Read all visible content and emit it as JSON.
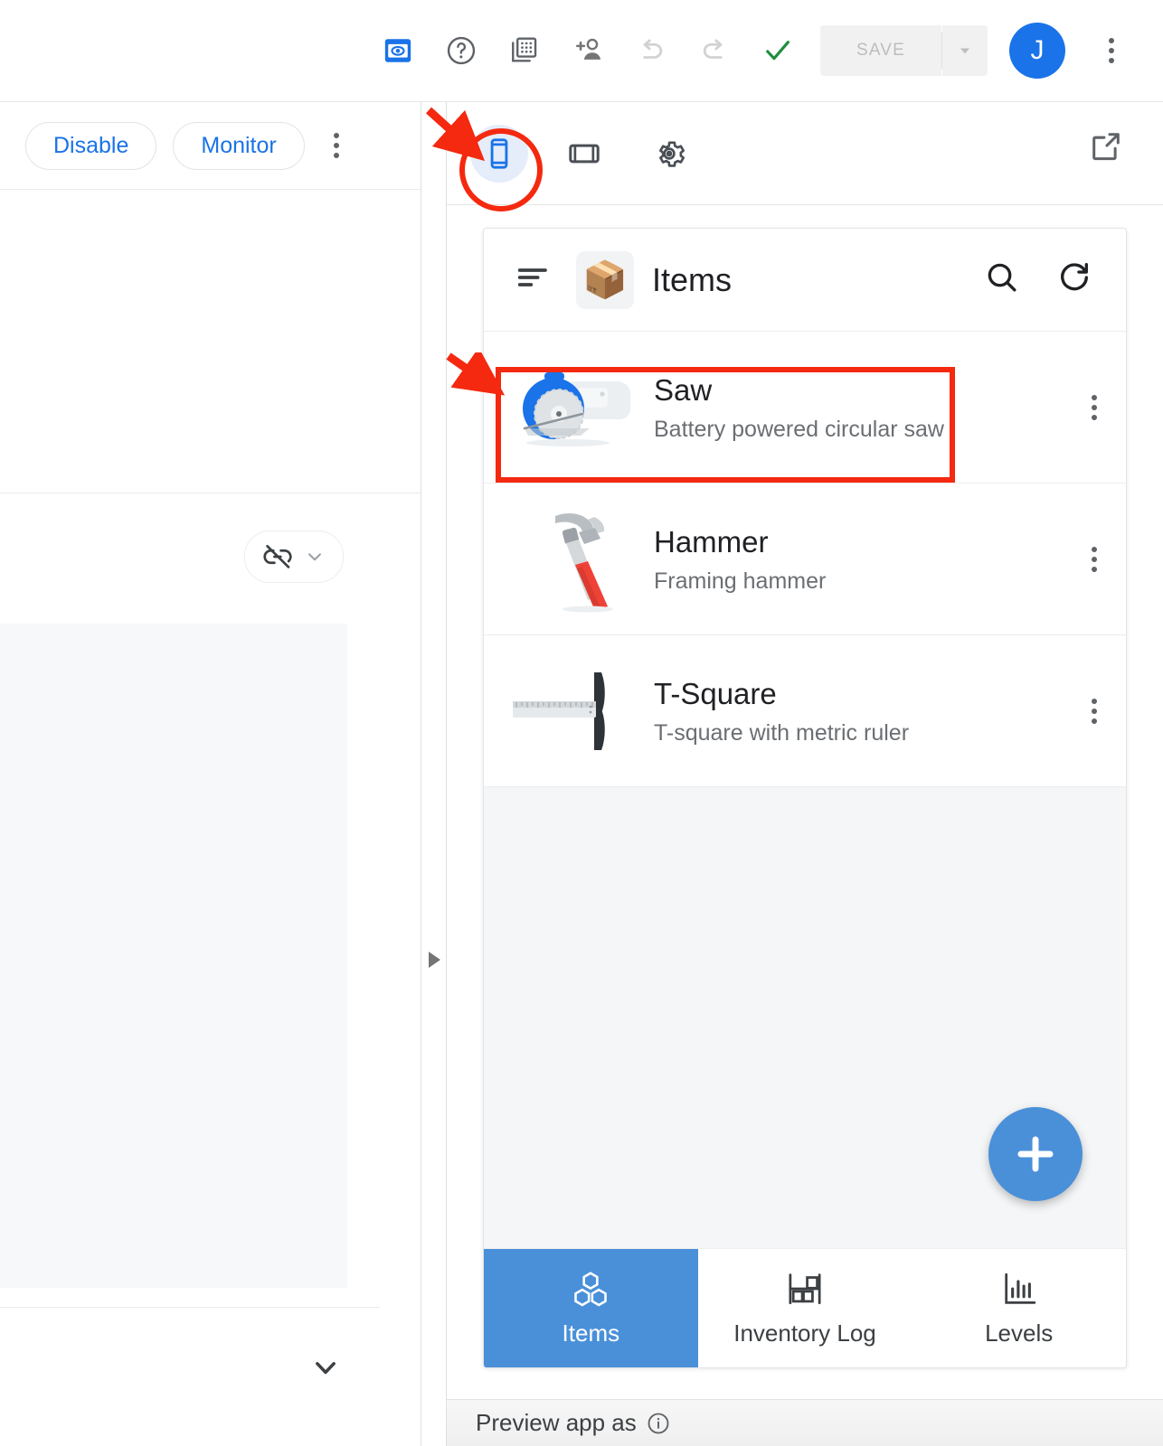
{
  "toolbar": {
    "icons": [
      {
        "name": "preview-icon",
        "label": "Preview"
      },
      {
        "name": "help-icon",
        "label": "Help"
      },
      {
        "name": "app-gallery-icon",
        "label": "App gallery"
      },
      {
        "name": "add-person-icon",
        "label": "Share"
      },
      {
        "name": "undo-icon",
        "label": "Undo"
      },
      {
        "name": "redo-icon",
        "label": "Redo"
      },
      {
        "name": "check-icon",
        "label": "Validated"
      }
    ],
    "save_label": "SAVE",
    "save_enabled": false,
    "save_dropdown_icon": "chevron-down-icon",
    "avatar_initial": "J",
    "overflow_icon": "more-vert-icon"
  },
  "left_panel": {
    "disable_label": "Disable",
    "monitor_label": "Monitor",
    "overflow_icon": "more-vert-icon",
    "link_off_icon": "link-off-icon",
    "link_dropdown_icon": "chevron-down-icon",
    "expand_icon": "chevron-down-icon"
  },
  "split_handle": {
    "expander_icon": "triangle-right-icon"
  },
  "preview_toolbar": {
    "devices": [
      {
        "name": "phone-view-button",
        "icon": "phone-icon",
        "label": "Phone",
        "active": true
      },
      {
        "name": "tablet-view-button",
        "icon": "tablet-icon",
        "label": "Tablet",
        "active": false
      },
      {
        "name": "preview-settings-button",
        "icon": "gear-icon",
        "label": "Settings",
        "active": false
      }
    ],
    "open_external_icon": "open-in-new-icon"
  },
  "app_preview": {
    "app_bar": {
      "menu_icon": "hamburger-menu-icon",
      "app_logo": "📦",
      "title": "Items",
      "search_icon": "search-icon",
      "refresh_icon": "refresh-icon"
    },
    "items": [
      {
        "title": "Saw",
        "subtitle": "Battery powered circular saw",
        "thumb": "circular-saw-image",
        "overflow_icon": "more-vert-icon",
        "highlighted": true
      },
      {
        "title": "Hammer",
        "subtitle": "Framing hammer",
        "thumb": "hammer-image",
        "overflow_icon": "more-vert-icon",
        "highlighted": false
      },
      {
        "title": "T-Square",
        "subtitle": "T-square with metric ruler",
        "thumb": "t-square-image",
        "overflow_icon": "more-vert-icon",
        "highlighted": false
      }
    ],
    "fab": {
      "icon": "plus-icon",
      "label": "Add item"
    },
    "bottom_nav": [
      {
        "label": "Items",
        "icon": "boxes-icon",
        "active": true
      },
      {
        "label": "Inventory Log",
        "icon": "shelf-icon",
        "active": false
      },
      {
        "label": "Levels",
        "icon": "bar-chart-icon",
        "active": false
      }
    ]
  },
  "preview_footer": {
    "text": "Preview app as",
    "info_icon": "info-icon"
  },
  "colors": {
    "accent_blue": "#1a73e8",
    "app_blue": "#4a90d9",
    "annotation_red": "#f4290f",
    "check_green": "#1e8e3e",
    "disabled_grey": "#bdbdbd"
  }
}
